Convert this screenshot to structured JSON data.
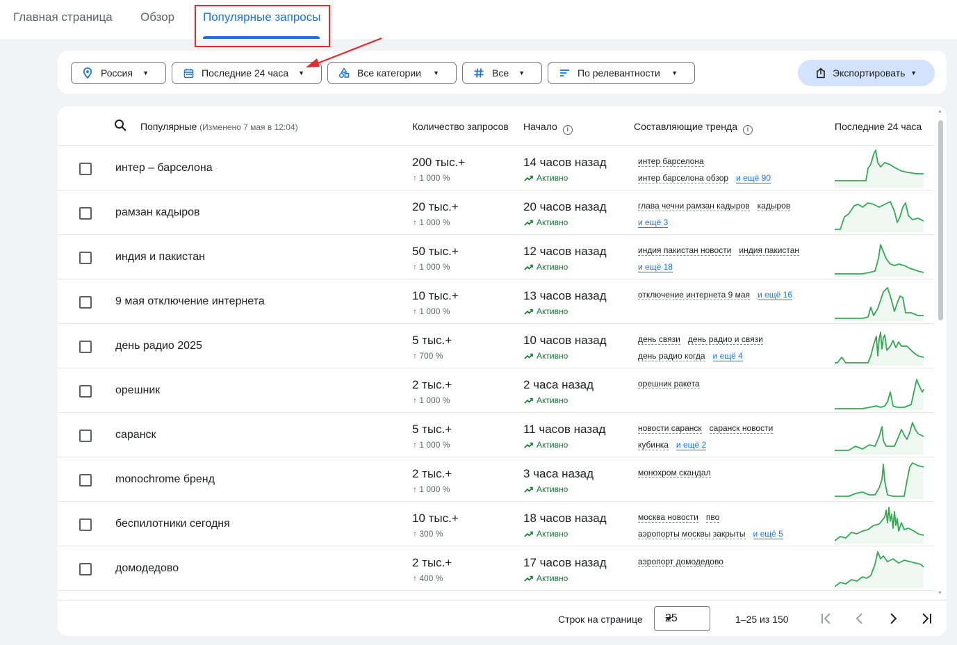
{
  "nav": {
    "tabs": [
      {
        "label": "Главная страница"
      },
      {
        "label": "Обзор"
      },
      {
        "label": "Популярные запросы"
      }
    ]
  },
  "filters": {
    "region": "Россия",
    "period": "Последние 24 часа",
    "category": "Все категории",
    "type": "Все",
    "sort": "По релевантности",
    "export": "Экспортировать"
  },
  "table": {
    "headers": {
      "trends": "Популярные",
      "trends_note": "(Изменено 7 мая в 12:04)",
      "volume": "Количество запросов",
      "started": "Начало",
      "breakdown": "Составляющие тренда",
      "last24": "Последние 24 часа"
    },
    "rows": [
      {
        "term": "интер – барселона",
        "volume": "200 тыс.+",
        "pct": "1 000 %",
        "started": "14 часов назад",
        "status": "Активно",
        "breakdown": [
          "интер барселона",
          "интер барселона обзор"
        ],
        "more": "и ещё 90"
      },
      {
        "term": "рамзан кадыров",
        "volume": "20 тыс.+",
        "pct": "1 000 %",
        "started": "20 часов назад",
        "status": "Активно",
        "breakdown": [
          "глава чечни рамзан кадыров",
          "кадыров"
        ],
        "more": "и ещё 3"
      },
      {
        "term": "индия и пакистан",
        "volume": "50 тыс.+",
        "pct": "1 000 %",
        "started": "12 часов назад",
        "status": "Активно",
        "breakdown": [
          "индия пакистан новости",
          "индия пакистан"
        ],
        "more": "и ещё 18"
      },
      {
        "term": "9 мая отключение интернета",
        "volume": "10 тыс.+",
        "pct": "1 000 %",
        "started": "13 часов назад",
        "status": "Активно",
        "breakdown": [
          "отключение интернета 9 мая"
        ],
        "more": "и ещё 16"
      },
      {
        "term": "день радио 2025",
        "volume": "5 тыс.+",
        "pct": "700 %",
        "started": "10 часов назад",
        "status": "Активно",
        "breakdown": [
          "день связи",
          "день радио и связи",
          "день радио когда"
        ],
        "more": "и ещё 4"
      },
      {
        "term": "орешник",
        "volume": "2 тыс.+",
        "pct": "1 000 %",
        "started": "2 часа назад",
        "status": "Активно",
        "breakdown": [
          "орешник ракета"
        ],
        "more": ""
      },
      {
        "term": "саранск",
        "volume": "5 тыс.+",
        "pct": "1 000 %",
        "started": "11 часов назад",
        "status": "Активно",
        "breakdown": [
          "новости саранск",
          "саранск новости",
          "кубинка"
        ],
        "more": "и ещё 2"
      },
      {
        "term": "monochrome бренд",
        "volume": "2 тыс.+",
        "pct": "1 000 %",
        "started": "3 часа назад",
        "status": "Активно",
        "breakdown": [
          "монохром скандал"
        ],
        "more": ""
      },
      {
        "term": "беспилотники сегодня",
        "volume": "10 тыс.+",
        "pct": "300 %",
        "started": "18 часов назад",
        "status": "Активно",
        "breakdown": [
          "москва новости",
          "пво",
          "аэропорты москвы закрыты"
        ],
        "more": "и ещё 5"
      },
      {
        "term": "домодедово",
        "volume": "2 тыс.+",
        "pct": "400 %",
        "started": "17 часов назад",
        "status": "Активно",
        "breakdown": [
          "аэропорт домодедово"
        ],
        "more": ""
      }
    ]
  },
  "footer": {
    "rows_label": "Строк на странице",
    "rows_value": "25",
    "range": "1–25 из 150"
  },
  "colors": {
    "accent": "#1a73e8",
    "spark": "#34a853",
    "highlight": "#e52a2a",
    "export_bg": "#d3e3fd"
  }
}
